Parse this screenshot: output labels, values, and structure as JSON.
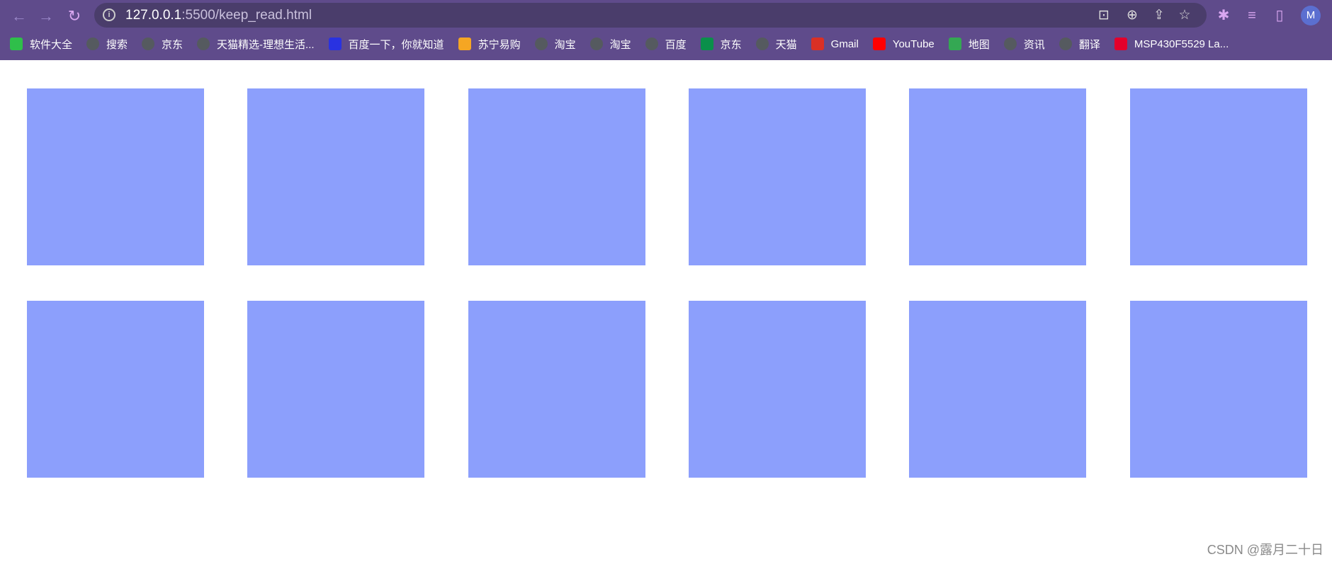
{
  "browser": {
    "url_host": "127.0.0.1",
    "url_rest": ":5500/keep_read.html",
    "avatar_letter": "M",
    "theme_color": "#5f4b8b"
  },
  "bookmarks": [
    {
      "label": "软件大全",
      "icon": "download-icon",
      "color": "#2fbf4a"
    },
    {
      "label": "搜索",
      "icon": "globe-icon",
      "color": "#555a5f"
    },
    {
      "label": "京东",
      "icon": "globe-icon",
      "color": "#555a5f"
    },
    {
      "label": "天猫精选-理想生活...",
      "icon": "globe-icon",
      "color": "#555a5f"
    },
    {
      "label": "百度一下，你就知道",
      "icon": "baidu-icon",
      "color": "#2932e1"
    },
    {
      "label": "苏宁易购",
      "icon": "suning-icon",
      "color": "#f5a623"
    },
    {
      "label": "淘宝",
      "icon": "globe-icon",
      "color": "#555a5f"
    },
    {
      "label": "淘宝",
      "icon": "globe-icon",
      "color": "#555a5f"
    },
    {
      "label": "百度",
      "icon": "globe-icon",
      "color": "#555a5f"
    },
    {
      "label": "京东",
      "icon": "jd-icon",
      "color": "#0a8f4a"
    },
    {
      "label": "天猫",
      "icon": "globe-icon",
      "color": "#555a5f"
    },
    {
      "label": "Gmail",
      "icon": "gmail-icon",
      "color": "#d93025"
    },
    {
      "label": "YouTube",
      "icon": "youtube-icon",
      "color": "#ff0000"
    },
    {
      "label": "地图",
      "icon": "maps-icon",
      "color": "#34a853"
    },
    {
      "label": "资讯",
      "icon": "globe-icon",
      "color": "#555a5f"
    },
    {
      "label": "翻译",
      "icon": "globe-icon",
      "color": "#555a5f"
    },
    {
      "label": "MSP430F5529 La...",
      "icon": "ti-icon",
      "color": "#e4002b"
    }
  ],
  "content": {
    "box_color": "#8c9ffc",
    "rows": 2,
    "columns": 6
  },
  "watermark": "CSDN @露月二十日"
}
